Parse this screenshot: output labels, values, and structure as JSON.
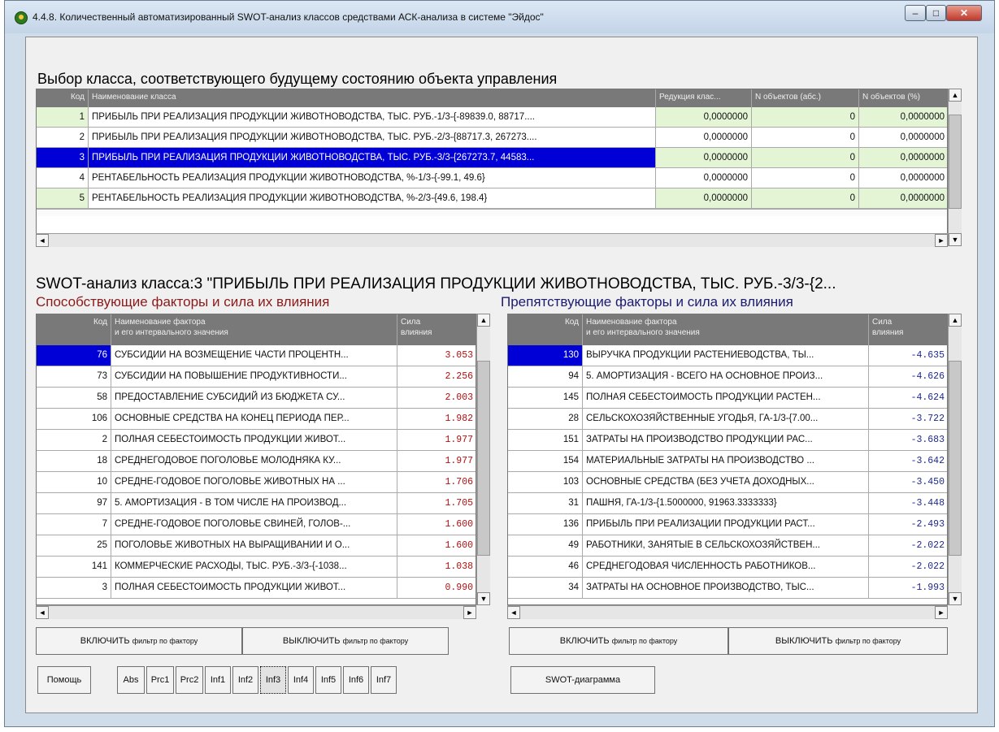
{
  "window": {
    "title": "4.4.8. Количественный автоматизированный SWOT-анализ классов средствами АСК-анализа в системе \"Эйдос\"",
    "controls": {
      "minimize": "–",
      "maximize": "□",
      "close": "✕"
    }
  },
  "class_section": {
    "heading": "Выбор класса, соответствующего будущему состоянию объекта управления",
    "columns": [
      "Код",
      "Наименование класса",
      "Редукция клас...",
      "N объектов (абс.)",
      "N объектов (%)"
    ],
    "rows": [
      {
        "code": "1",
        "name": "ПРИБЫЛЬ ПРИ РЕАЛИЗАЦИЯ ПРОДУКЦИИ ЖИВОТНОВОДСТВА, ТЫС. РУБ.-1/3-{-89839.0, 88717....",
        "reduction": "0,0000000",
        "n_abs": "0",
        "n_pct": "0,0000000"
      },
      {
        "code": "2",
        "name": "ПРИБЫЛЬ ПРИ РЕАЛИЗАЦИЯ ПРОДУКЦИИ ЖИВОТНОВОДСТВА, ТЫС. РУБ.-2/3-{88717.3, 267273....",
        "reduction": "0,0000000",
        "n_abs": "0",
        "n_pct": "0,0000000"
      },
      {
        "code": "3",
        "name": "ПРИБЫЛЬ ПРИ РЕАЛИЗАЦИЯ ПРОДУКЦИИ ЖИВОТНОВОДСТВА, ТЫС. РУБ.-3/3-{267273.7, 44583...",
        "reduction": "0,0000000",
        "n_abs": "0",
        "n_pct": "0,0000000"
      },
      {
        "code": "4",
        "name": "РЕНТАБЕЛЬНОСТЬ РЕАЛИЗАЦИЯ ПРОДУКЦИИ ЖИВОТНОВОДСТВА, %-1/3-{-99.1, 49.6}",
        "reduction": "0,0000000",
        "n_abs": "0",
        "n_pct": "0,0000000"
      },
      {
        "code": "5",
        "name": "РЕНТАБЕЛЬНОСТЬ РЕАЛИЗАЦИЯ ПРОДУКЦИИ ЖИВОТНОВОДСТВА, %-2/3-{49.6, 198.4}",
        "reduction": "0,0000000",
        "n_abs": "0",
        "n_pct": "0,0000000"
      }
    ]
  },
  "swot_title": "SWOT-анализ класса:3 \"ПРИБЫЛЬ ПРИ РЕАЛИЗАЦИЯ ПРОДУКЦИИ ЖИВОТНОВОДСТВА, ТЫС. РУБ.-3/3-{2...",
  "promoting": {
    "heading": "Способствующие факторы и сила их влияния",
    "columns": {
      "code": "Код",
      "name1": "Наименование фактора",
      "name2": "и его интервального значения",
      "force1": "Сила",
      "force2": "влияния"
    },
    "rows": [
      {
        "code": "76",
        "name": "СУБСИДИИ НА ВОЗМЕЩЕНИЕ ЧАСТИ ПРОЦЕНТН...",
        "force": "3.053"
      },
      {
        "code": "73",
        "name": "СУБСИДИИ НА ПОВЫШЕНИЕ ПРОДУКТИВНОСТИ...",
        "force": "2.256"
      },
      {
        "code": "58",
        "name": "ПРЕДОСТАВЛЕНИЕ СУБСИДИЙ ИЗ БЮДЖЕТА СУ...",
        "force": "2.003"
      },
      {
        "code": "106",
        "name": "ОСНОВНЫЕ СРЕДСТВА НА КОНЕЦ ПЕРИОДА ПЕР...",
        "force": "1.982"
      },
      {
        "code": "2",
        "name": "ПОЛНАЯ СЕБЕСТОИМОСТЬ ПРОДУКЦИИ ЖИВОТ...",
        "force": "1.977"
      },
      {
        "code": "18",
        "name": "СРЕДНЕГОДОВОЕ ПОГОЛОВЬЕ МОЛОДНЯКА КУ...",
        "force": "1.977"
      },
      {
        "code": "10",
        "name": "СРЕДНЕ-ГОДОВОЕ ПОГОЛОВЬЕ ЖИВОТНЫХ НА ...",
        "force": "1.706"
      },
      {
        "code": "97",
        "name": "5. АМОРТИЗАЦИЯ - В ТОМ ЧИСЛЕ НА ПРОИЗВОД...",
        "force": "1.705"
      },
      {
        "code": "7",
        "name": "СРЕДНЕ-ГОДОВОЕ ПОГОЛОВЬЕ СВИНЕЙ, ГОЛОВ-...",
        "force": "1.600"
      },
      {
        "code": "25",
        "name": "ПОГОЛОВЬЕ ЖИВОТНЫХ НА ВЫРАЩИВАНИИ И О...",
        "force": "1.600"
      },
      {
        "code": "141",
        "name": "КОММЕРЧЕСКИЕ РАСХОДЫ, ТЫС. РУБ.-3/3-{-1038...",
        "force": "1.038"
      },
      {
        "code": "3",
        "name": "ПОЛНАЯ СЕБЕСТОИМОСТЬ ПРОДУКЦИИ ЖИВОТ...",
        "force": "0.990"
      }
    ]
  },
  "hindering": {
    "heading": "Препятствующие факторы и сила их влияния",
    "columns": {
      "code": "Код",
      "name1": "Наименование фактора",
      "name2": "и его интервального значения",
      "force1": "Сила",
      "force2": "влияния"
    },
    "rows": [
      {
        "code": "130",
        "name": "ВЫРУЧКА ПРОДУКЦИИ РАСТЕНИЕВОДСТВА, ТЫ...",
        "force": "-4.635"
      },
      {
        "code": "94",
        "name": "5. АМОРТИЗАЦИЯ - ВСЕГО НА ОСНОВНОЕ ПРОИЗ...",
        "force": "-4.626"
      },
      {
        "code": "145",
        "name": "ПОЛНАЯ СЕБЕСТОИМОСТЬ ПРОДУКЦИИ РАСТЕН...",
        "force": "-4.624"
      },
      {
        "code": "28",
        "name": "СЕЛЬСКОХОЗЯЙСТВЕННЫЕ УГОДЬЯ, ГА-1/3-{7.00...",
        "force": "-3.722"
      },
      {
        "code": "151",
        "name": "ЗАТРАТЫ НА ПРОИЗВОДСТВО ПРОДУКЦИИ РАС...",
        "force": "-3.683"
      },
      {
        "code": "154",
        "name": "МАТЕРИАЛЬНЫЕ ЗАТРАТЫ НА ПРОИЗВОДСТВО ...",
        "force": "-3.642"
      },
      {
        "code": "103",
        "name": "ОСНОВНЫЕ СРЕДСТВА (БЕЗ УЧЕТА ДОХОДНЫХ...",
        "force": "-3.450"
      },
      {
        "code": "31",
        "name": "ПАШНЯ, ГА-1/3-{1.5000000, 91963.3333333}",
        "force": "-3.448"
      },
      {
        "code": "136",
        "name": "ПРИБЫЛЬ ПРИ РЕАЛИЗАЦИИ ПРОДУКЦИИ РАСТ...",
        "force": "-2.493"
      },
      {
        "code": "49",
        "name": "РАБОТНИКИ, ЗАНЯТЫЕ В СЕЛЬСКОХОЗЯЙСТВЕН...",
        "force": "-2.022"
      },
      {
        "code": "46",
        "name": "СРЕДНЕГОДОВАЯ ЧИСЛЕННОСТЬ РАБОТНИКОВ...",
        "force": "-2.022"
      },
      {
        "code": "34",
        "name": "ЗАТРАТЫ НА ОСНОВНОЕ ПРОИЗВОДСТВО, ТЫС...",
        "force": "-1.993"
      }
    ]
  },
  "buttons": {
    "filter_on_main": "ВКЛЮЧИТЬ",
    "filter_off_main": "ВЫКЛЮЧИТЬ",
    "filter_suffix": "фильтр по фактору",
    "help": "Помощь",
    "models": [
      "Abs",
      "Prc1",
      "Prc2",
      "Inf1",
      "Inf2",
      "Inf3",
      "Inf4",
      "Inf5",
      "Inf6",
      "Inf7"
    ],
    "selected_model": "Inf3",
    "swot_diagram": "SWOT-диаграмма"
  }
}
